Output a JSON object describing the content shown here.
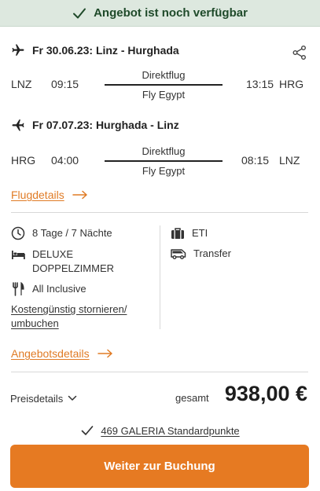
{
  "banner": {
    "text": "Angebot ist noch verfügbar",
    "icon": "check-icon",
    "color": "#dde8df"
  },
  "outbound": {
    "title": "Fr 30.06.23: Linz - Hurghada",
    "from_code": "LNZ",
    "dep_time": "09:15",
    "type": "Direktflug",
    "airline": "Fly Egypt",
    "arr_time": "13:15",
    "to_code": "HRG"
  },
  "inbound": {
    "title": "Fr 07.07.23: Hurghada - Linz",
    "from_code": "HRG",
    "dep_time": "04:00",
    "type": "Direktflug",
    "airline": "Fly Egypt",
    "arr_time": "08:15",
    "to_code": "LNZ"
  },
  "flight_details_link": "Flugdetails",
  "info": {
    "duration": "8 Tage / 7 Nächte",
    "room_line1": "DELUXE",
    "room_line2": "DOPPELZIMMER",
    "board": "All Inclusive",
    "cancel_line1": "Kostengünstig stornieren/",
    "cancel_line2": "umbuchen",
    "operator": "ETI",
    "transfer": "Transfer"
  },
  "offer_details_link": "Angebotsdetails",
  "price": {
    "details_label": "Preisdetails",
    "total_label": "gesamt",
    "amount": "938,00 €"
  },
  "points": {
    "text": "469 GALERIA Standardpunkte"
  },
  "cta": {
    "label": "Weiter zur Buchung",
    "color": "#e67a22"
  },
  "accent_color": "#e07b25"
}
